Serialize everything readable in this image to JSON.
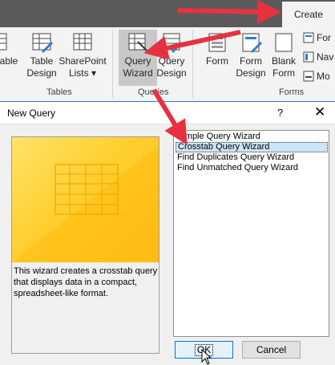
{
  "ribbon": {
    "active_tab": "Create",
    "buttons": {
      "table_partial": "able",
      "table_design_1": "Table",
      "table_design_2": "Design",
      "sharepoint_1": "SharePoint",
      "sharepoint_2": "Lists",
      "query_wizard_1": "Query",
      "query_wizard_2": "Wizard",
      "query_design_1": "Query",
      "query_design_2": "Design",
      "form": "Form",
      "form_design_1": "Form",
      "form_design_2": "Design",
      "blank_form_1": "Blank",
      "blank_form_2": "Form",
      "form_wizard_partial": "For",
      "navigation_partial": "Nav",
      "more_forms_partial": "Mo"
    },
    "groups": {
      "tables": "Tables",
      "queries": "Queries",
      "forms": "Forms"
    }
  },
  "dialog": {
    "title": "New Query",
    "help": "?",
    "close": "✕",
    "description": "This wizard creates a crosstab query that displays data in a compact, spreadsheet-like format.",
    "options": [
      "Simple Query Wizard",
      "Crosstab Query Wizard",
      "Find Duplicates Query Wizard",
      "Find Unmatched Query Wizard"
    ],
    "selected_index": 1,
    "ok_label": "OK",
    "cancel_label": "Cancel"
  },
  "colors": {
    "annotation_arrow": "#e8313f",
    "dialog_border_accent": "#2d7bd5",
    "selection": "#cce4f7"
  }
}
